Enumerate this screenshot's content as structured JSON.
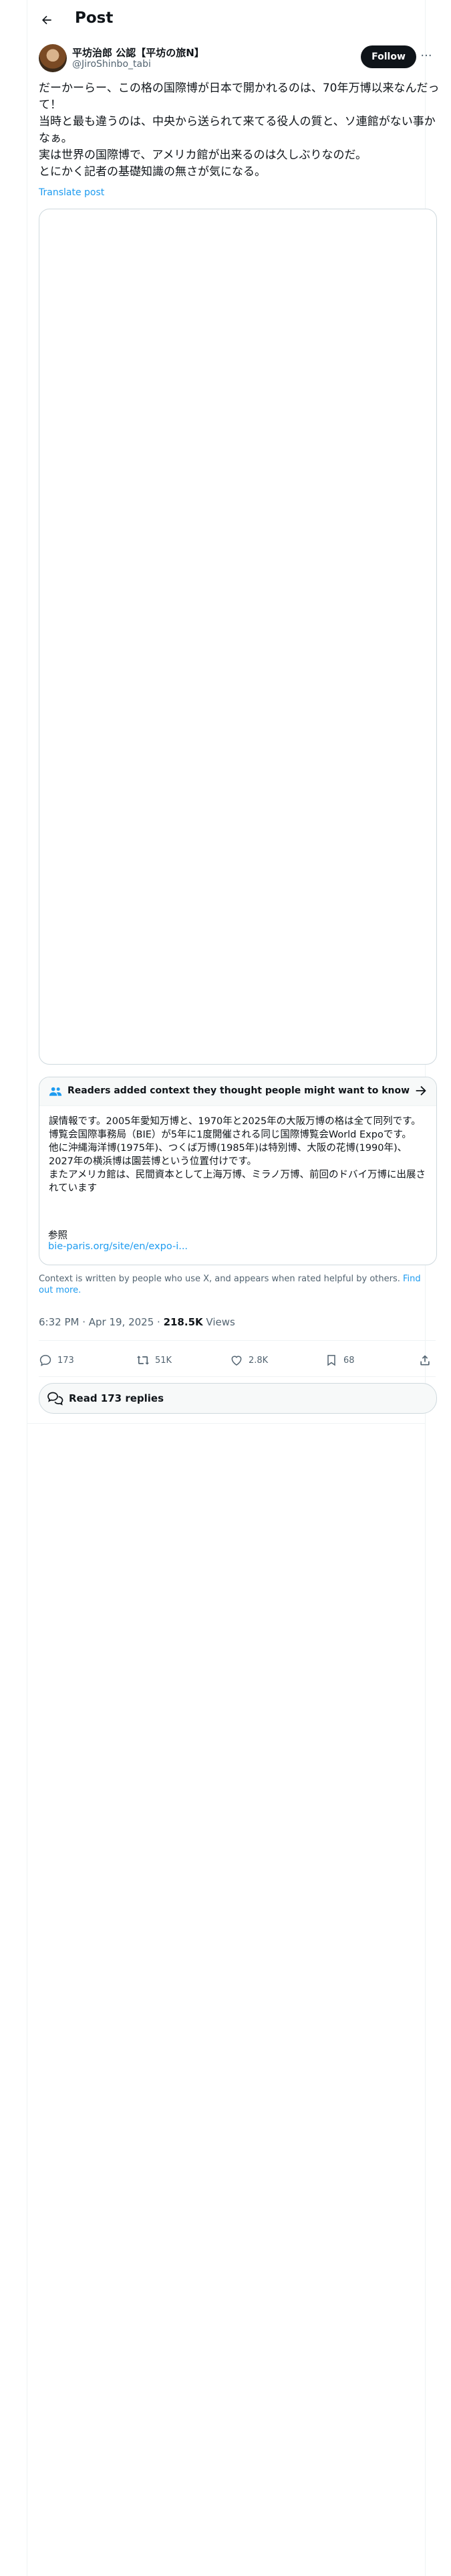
{
  "header": {
    "title": "Post",
    "back_icon": "arrow-left-icon"
  },
  "author": {
    "name": "平坊治郎 公認【平坊の旅N】",
    "handle": "@JiroShinbo_tabi",
    "follow_label": "Follow",
    "more_icon": "ellipsis-icon"
  },
  "post": {
    "text": "だーかーらー、この格の国際博が日本で開かれるのは、70年万博以来なんだって！\n当時と最も違うのは、中央から送られて来てる役人の質と、ソ連館がない事かなぁ。\n実は世界の国際博で、アメリカ館が出来るのは久しぶりなのだ。\nとにかく記者の基礎知識の無さが気になる。",
    "translate_label": "Translate post"
  },
  "community_note": {
    "title": "Readers added context they thought people might want to know",
    "body": "誤情報です。2005年愛知万博と、1970年と2025年の大阪万博の格は全て同列です。博覧会国際事務局（BIE）が5年に1度開催される同じ国際博覧会World Expoです。\n他に沖縄海洋博(1975年)、つくば万博(1985年)は特別博、大阪の花博(1990年)、2027年の横浜博は園芸博という位置付けです。\nまたアメリカ館は、民間資本として上海万博、ミラノ万博、前回のドバイ万博に出展されています",
    "ref_label": "参照",
    "ref_link": "bie-paris.org/site/en/expo-i...",
    "disclaimer": "Context is written by people who use X, and appears when rated helpful by others.",
    "find_out_more": "Find out more."
  },
  "meta": {
    "time": "6:32 PM · Apr 19, 2025 · ",
    "views_count": "218.5K",
    "views_label": " Views"
  },
  "actions": {
    "replies": "173",
    "reposts": "51K",
    "likes": "2.8K",
    "bookmarks": "68"
  },
  "read_replies": {
    "label": "Read 173 replies"
  },
  "colors": {
    "accent": "#1d9bf0",
    "text": "#0f1419",
    "muted": "#536471",
    "border": "#cfd9de"
  }
}
